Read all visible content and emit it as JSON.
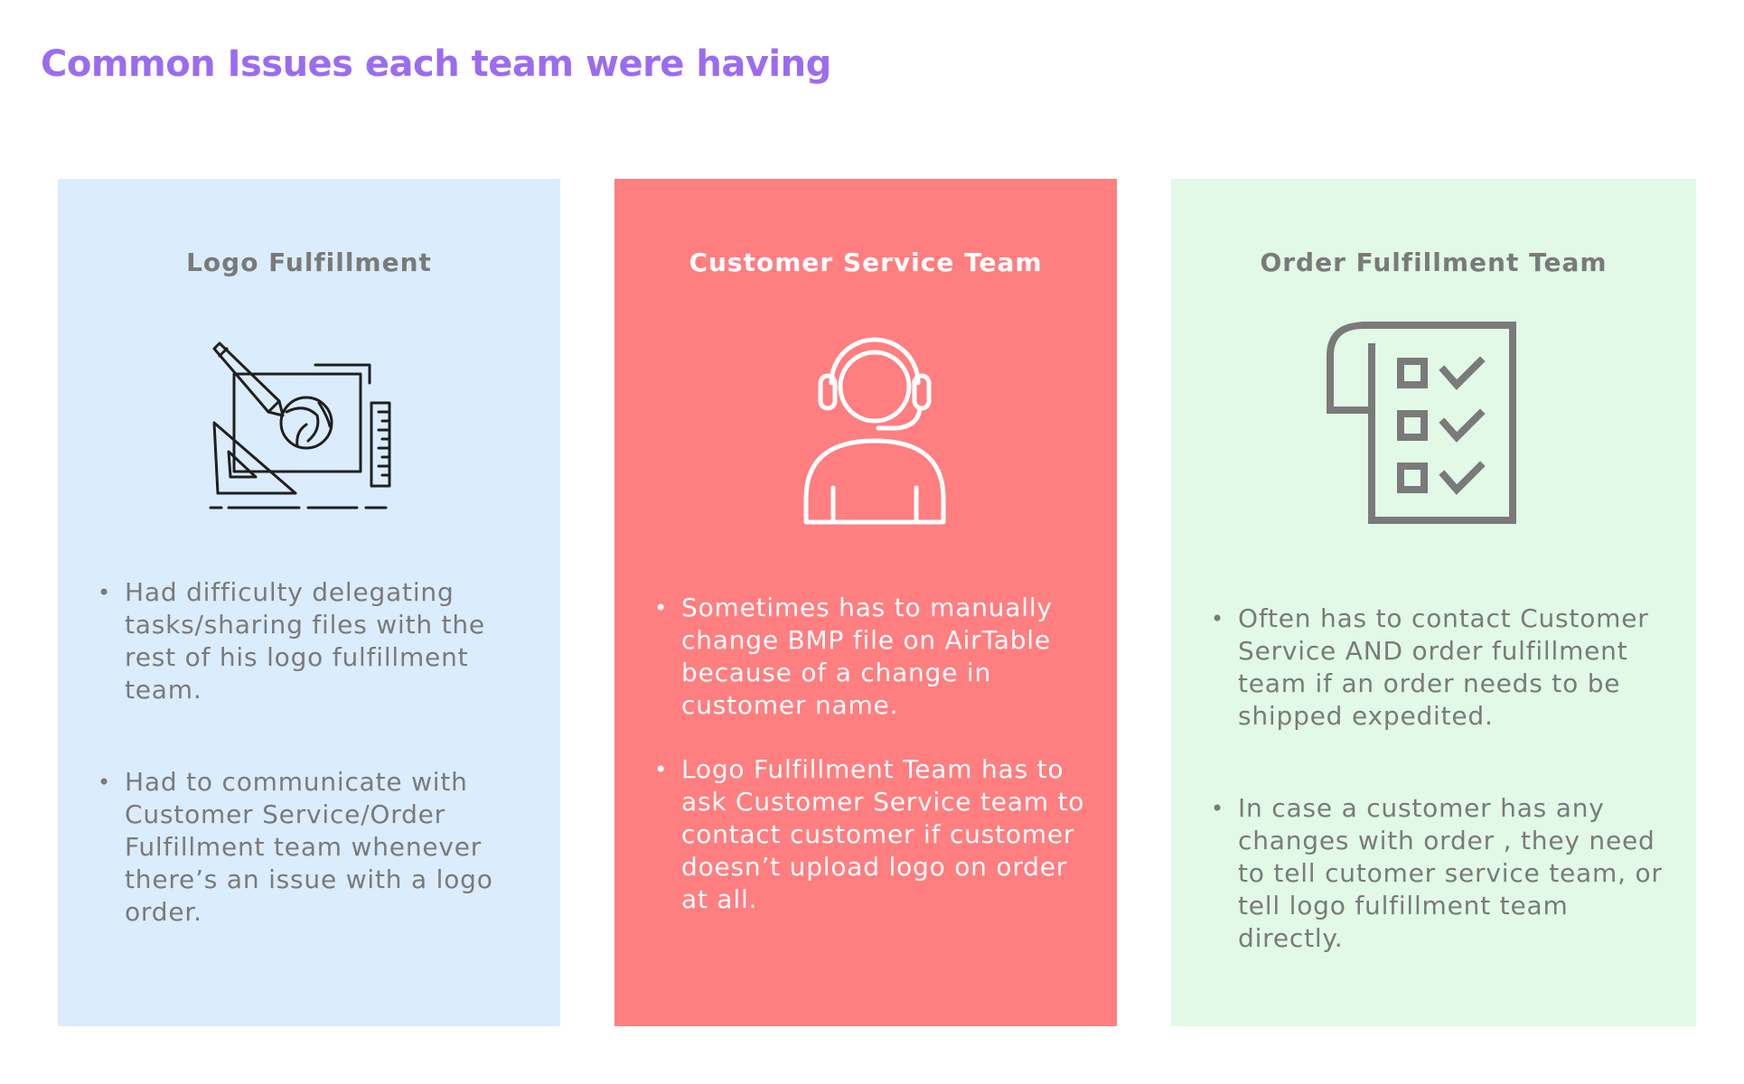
{
  "page": {
    "title": "Common Issues each team were having",
    "title_color": "#9b6cf0"
  },
  "cards": [
    {
      "title": "Logo Fulfillment",
      "icon": "design-tools-icon",
      "background": "#dbecfd",
      "bullets": [
        "Had difficulty delegating tasks/sharing files with the rest of his logo fulfillment team.",
        "Had to communicate with Customer Service/Order Fulfillment team whenever there’s an issue with a logo order."
      ]
    },
    {
      "title": "Customer Service Team",
      "icon": "headset-agent-icon",
      "background": "#ff7e80",
      "bullets": [
        "Sometimes has to manually change BMP file on AirTable because of a change in customer name.",
        "Logo Fulfillment Team has to ask Customer Service team to contact customer if customer doesn’t upload logo on order at all."
      ]
    },
    {
      "title": "Order Fulfillment Team",
      "icon": "checklist-icon",
      "background": "#e1f9e6",
      "bullets": [
        "Often has to contact Customer Service AND order fulfillment team if an order needs to be shipped expedited.",
        "In case a customer has any changes with order , they need to tell cutomer service team, or tell logo fulfillment team directly."
      ]
    }
  ]
}
